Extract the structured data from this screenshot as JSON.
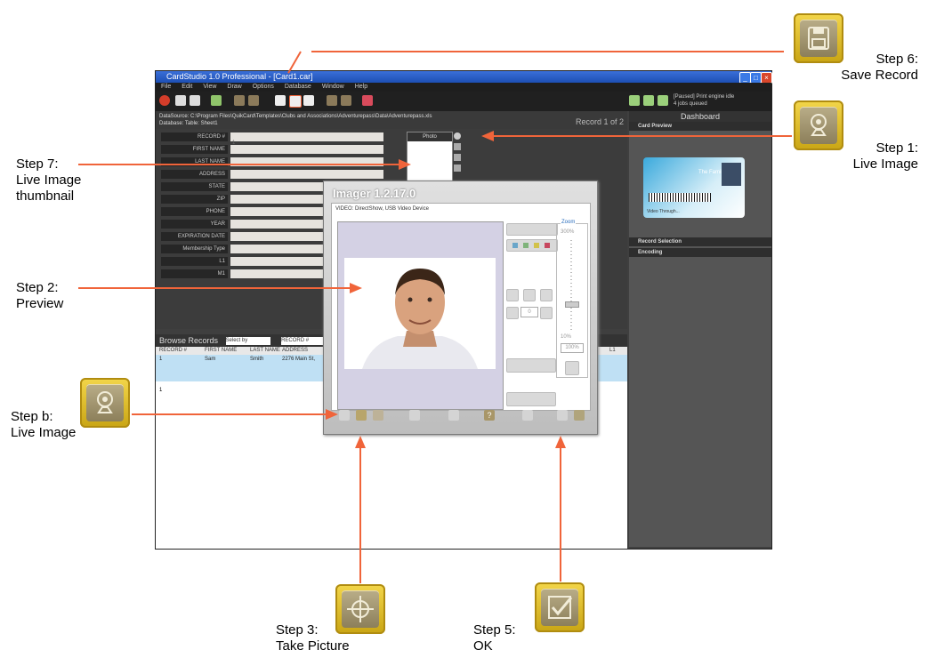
{
  "app": {
    "window_title": "CardStudio 1.0 Professional - [Card1.car]",
    "menu": [
      "File",
      "Edit",
      "View",
      "Draw",
      "Options",
      "Database",
      "Window",
      "Help"
    ],
    "engine_status": "[Paused] Print engine idle",
    "jobs_queued": "4 jobs queued",
    "datasource_line": "DataSource: C:\\Program Files\\QuikCard\\Templates\\Clubs and Associations\\Adventurepass\\Data\\Adventurepass.xls",
    "database_line": "Database:       Table: Sheet1",
    "record_counter": "Record 1 of 2",
    "record_value": "1",
    "form_fields": [
      "RECORD #",
      "FIRST NAME",
      "LAST NAME",
      "ADDRESS",
      "STATE",
      "ZIP",
      "PHONE",
      "YEAR",
      "EXPIRATION DATE",
      "Membership Type",
      "L1",
      "M1"
    ],
    "photo_label": "Photo",
    "dashboard": {
      "title": "Dashboard",
      "sections": [
        "Card Preview",
        "Record Selection",
        "Encoding"
      ],
      "card_family": "The Family",
      "card_video": "Video Through..."
    },
    "browse": {
      "title": "Browse Records",
      "select_by": "Select by",
      "field": "RECORD #",
      "columns": [
        "RECORD #",
        "FIRST NAME",
        "LAST NAME",
        "ADDRESS",
        "L1"
      ],
      "rows": [
        [
          "1",
          "Sam",
          "Smith",
          "2276 Main St,"
        ],
        [
          "1",
          "",
          "",
          ""
        ]
      ]
    }
  },
  "imager": {
    "title": "Imager 1.2.17.0",
    "video_source": "VIDEO: DirectShow, USB Video Device",
    "zoom_label": "Zoom",
    "zoom_max": "300%",
    "zoom_min": "10%",
    "zoom_value": "100%",
    "rotate_value": "0"
  },
  "callouts": {
    "step6": [
      "Step 6:",
      "Save Record"
    ],
    "step1": [
      "Step 1:",
      "Live Image"
    ],
    "step7": [
      "Step 7:",
      "Live Image",
      "thumbnail"
    ],
    "step2": [
      "Step 2:",
      "Preview"
    ],
    "stepb": [
      "Step b:",
      "Live Image"
    ],
    "step3": [
      "Step 3:",
      "Take Picture"
    ],
    "step5": [
      "Step 5:",
      "OK"
    ]
  },
  "colors": {
    "arrow": "#f0643a",
    "badge_gold": "#e5c231",
    "window_bg": "#3f3f3f",
    "titlebar": "#1d4fb4"
  },
  "icons": {
    "save": "floppy-disk-icon",
    "live": "webcam-icon",
    "capture": "crosshair-icon",
    "ok": "checkmark-icon"
  }
}
